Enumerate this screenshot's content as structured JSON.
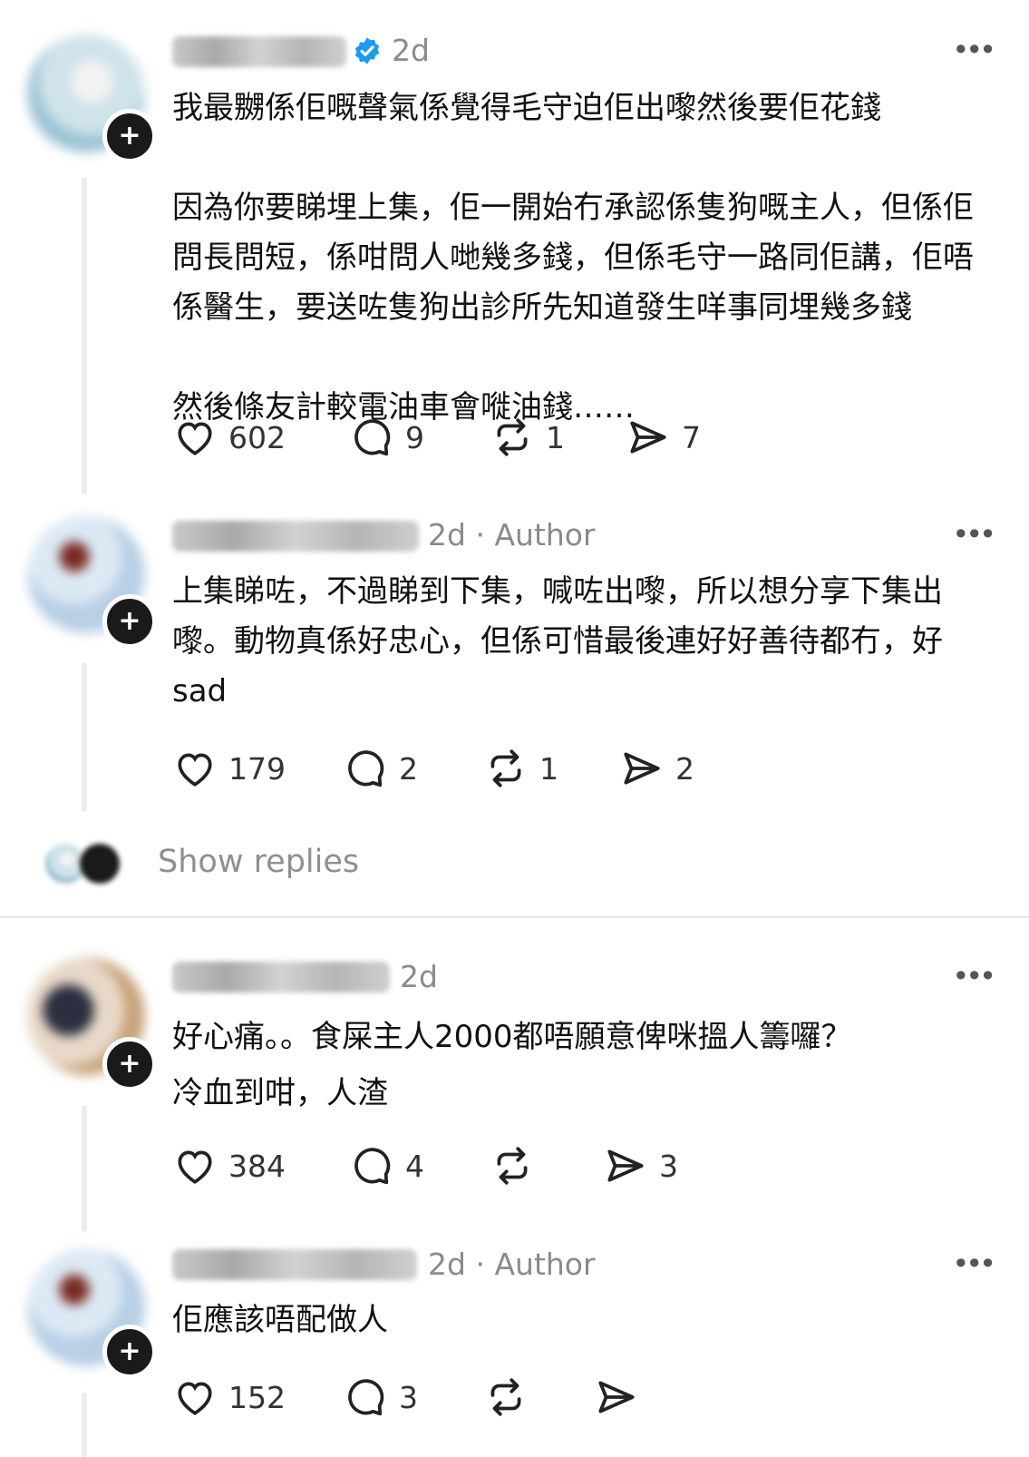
{
  "comments": [
    {
      "time": "2d",
      "verified": true,
      "author_tag": "",
      "body": "我最嬲係佢嘅聲氣係覺得毛守迫佢出嚟然後要佢花錢\n\n因為你要睇埋上集，佢一開始冇承認係隻狗嘅主人，但係佢問長問短，係咁問人哋幾多錢，但係毛守一路同佢講，佢唔係醫生，要送咗隻狗出診所先知道發生咩事同埋幾多錢\n\n然後條友計較電油車會嘥油錢……",
      "likes": "602",
      "replies": "9",
      "reposts": "1",
      "shares": "7"
    },
    {
      "time": "2d",
      "author_tag": "Author",
      "body": "上集睇咗，不過睇到下集，喊咗出嚟，所以想分享下集出嚟。動物真係好忠心，但係可惜最後連好好善待都冇，好 sad",
      "likes": "179",
      "replies": "2",
      "reposts": "1",
      "shares": "2"
    },
    {
      "time": "2d",
      "author_tag": "",
      "body": "好心痛。。食屎主人2000都唔願意俾咪搵人籌囉？\n冷血到咁，人渣",
      "likes": "384",
      "replies": "4",
      "reposts": "",
      "shares": "3"
    },
    {
      "time": "2d",
      "author_tag": "Author",
      "body": "佢應該唔配做人",
      "likes": "152",
      "replies": "3",
      "reposts": "",
      "shares": ""
    }
  ],
  "show_replies_label": "Show replies",
  "separator": "·",
  "more_label": "•••",
  "colors": {
    "verified": "#1d9bf0",
    "muted": "#8a8a8a"
  },
  "icons": [
    "heart-icon",
    "comment-icon",
    "repost-icon",
    "share-icon",
    "verified-icon",
    "follow-plus-icon",
    "more-icon"
  ]
}
